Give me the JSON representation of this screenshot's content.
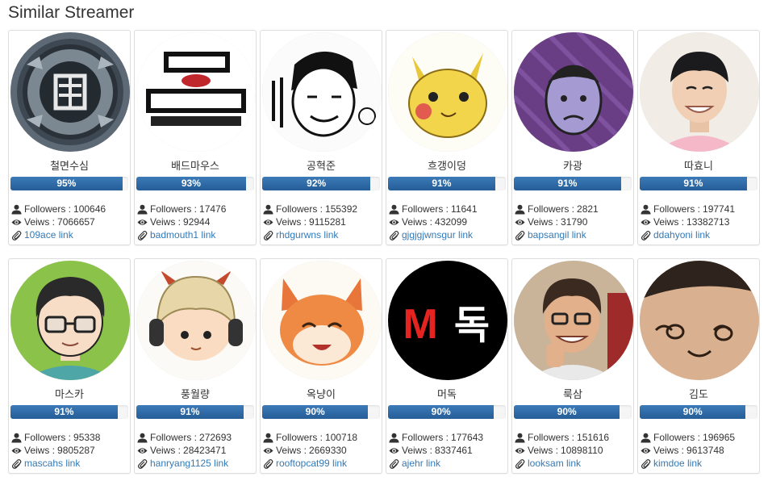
{
  "section_title": "Similar Streamer",
  "colors": {
    "progress_bar": "#2f6ea8",
    "link": "#337ab7",
    "border": "#dddddd"
  },
  "labels": {
    "followers": "Followers : ",
    "views": "Veiws : "
  },
  "streamers": [
    {
      "name": "철면수심",
      "match": "95%",
      "followers": "100646",
      "views": "7066657",
      "link": "109ace link",
      "avatar": "steel-emblem"
    },
    {
      "name": "배드마우스",
      "match": "93%",
      "followers": "17476",
      "views": "92944",
      "link": "badmouth1 link",
      "avatar": "bad-mouth-logo"
    },
    {
      "name": "공혁준",
      "match": "92%",
      "followers": "155392",
      "views": "9115281",
      "link": "rhdgurwns link",
      "avatar": "sketch-face"
    },
    {
      "name": "흐갱이덩",
      "match": "91%",
      "followers": "11641",
      "views": "432099",
      "link": "gjgjgjwnsgur link",
      "avatar": "yellow-pokemon"
    },
    {
      "name": "카광",
      "match": "91%",
      "followers": "2821",
      "views": "31790",
      "link": "bapsangil link",
      "avatar": "purple-cartoon"
    },
    {
      "name": "따효니",
      "match": "91%",
      "followers": "197741",
      "views": "13382713",
      "link": "ddahyoni link",
      "avatar": "smiling-man"
    },
    {
      "name": "마스카",
      "match": "91%",
      "followers": "95338",
      "views": "9805287",
      "link": "mascahs link",
      "avatar": "glasses-cartoon"
    },
    {
      "name": "풍월량",
      "match": "91%",
      "followers": "272693",
      "views": "28423471",
      "link": "hanryang1125 link",
      "avatar": "headphone-cartoon"
    },
    {
      "name": "옥냥이",
      "match": "90%",
      "followers": "100718",
      "views": "2669330",
      "link": "rooftopcat99 link",
      "avatar": "orange-cat"
    },
    {
      "name": "머독",
      "match": "90%",
      "followers": "177643",
      "views": "8337461",
      "link": "ajehr link",
      "avatar": "m-dok-logo",
      "avatar_text": {
        "left": "M",
        "right": "독"
      }
    },
    {
      "name": "룩삼",
      "match": "90%",
      "followers": "151616",
      "views": "10898110",
      "link": "looksam link",
      "avatar": "laughing-man"
    },
    {
      "name": "김도",
      "match": "90%",
      "followers": "196965",
      "views": "9613748",
      "link": "kimdoe link",
      "avatar": "drawn-face-hand"
    }
  ]
}
